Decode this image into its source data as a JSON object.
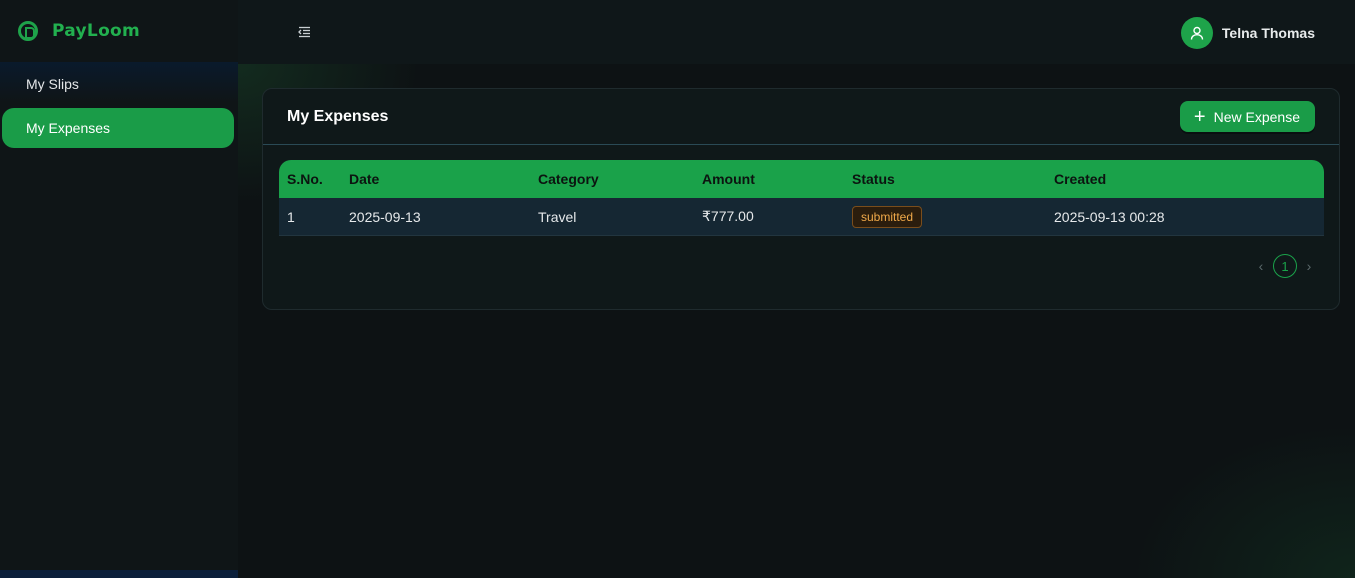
{
  "app": {
    "brand_name": "PayLoom",
    "brand_color": "#22b04f"
  },
  "sidebar": {
    "items": [
      {
        "label": "My Slips",
        "active": false
      },
      {
        "label": "My Expenses",
        "active": true
      }
    ]
  },
  "topbar": {
    "menu_icon": "menu-collapse-icon",
    "user_name": "Telna Thomas",
    "avatar_icon": "user-icon"
  },
  "card": {
    "title": "My Expenses",
    "new_button_label": "New Expense",
    "new_button_icon": "plus-icon"
  },
  "table": {
    "columns": [
      "S.No.",
      "Date",
      "Category",
      "Amount",
      "Status",
      "Created"
    ],
    "rows": [
      {
        "sno": "1",
        "date": "2025-09-13",
        "category": "Travel",
        "amount": "₹777.00",
        "status": "submitted",
        "created": "2025-09-13 00:28"
      }
    ]
  },
  "pagination": {
    "current_page": "1",
    "prev_icon": "chevron-left-icon",
    "next_icon": "chevron-right-icon"
  },
  "colors": {
    "accent": "#1a9c48",
    "status_submitted": "#f0a94a"
  }
}
